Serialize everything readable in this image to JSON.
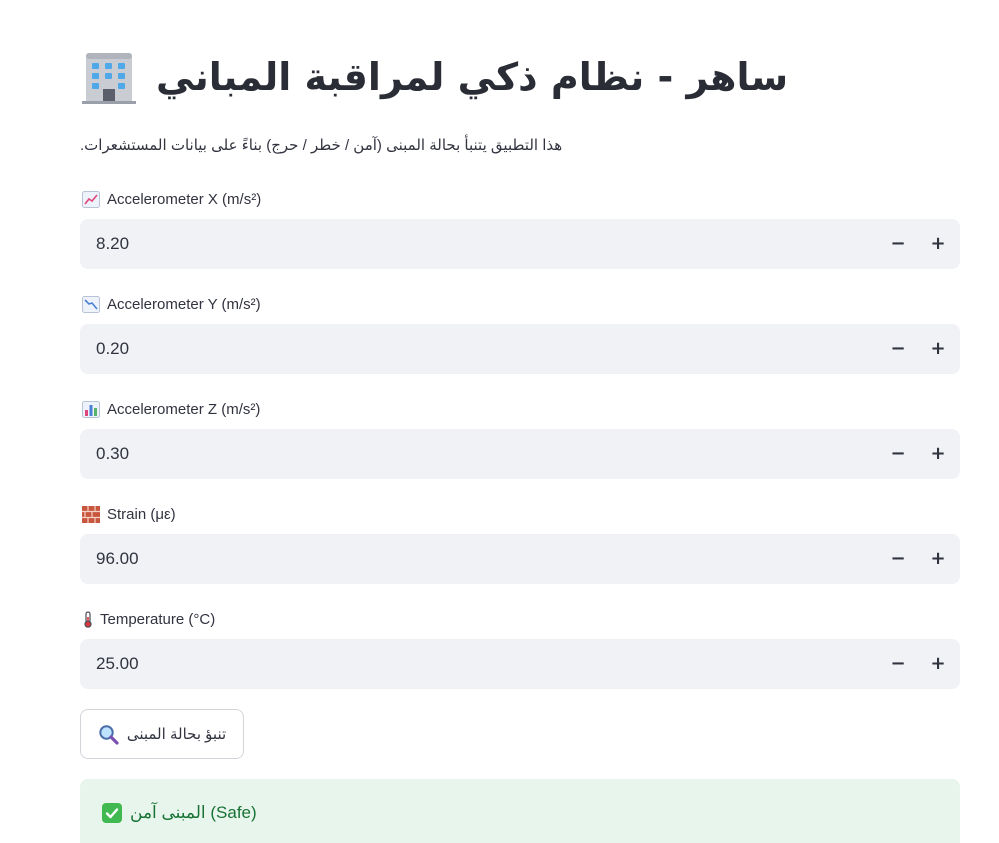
{
  "header": {
    "title": "ساهر - نظام ذكي لمراقبة المباني",
    "title_icon": "office-building-icon"
  },
  "description": ".هذا التطبيق يتنبأ بحالة المبنى (آمن / خطر / حرج) بناءً على بيانات المستشعرات",
  "fields": [
    {
      "label": "Accelerometer X (m/s²)",
      "icon": "chart-increasing-icon",
      "value": "8.20",
      "minus": "−",
      "plus": "+"
    },
    {
      "label": "Accelerometer Y (m/s²)",
      "icon": "chart-decreasing-icon",
      "value": "0.20",
      "minus": "−",
      "plus": "+"
    },
    {
      "label": "Accelerometer Z (m/s²)",
      "icon": "bar-chart-icon",
      "value": "0.30",
      "minus": "−",
      "plus": "+"
    },
    {
      "label": "Strain (με)",
      "icon": "brick-icon",
      "value": "96.00",
      "minus": "−",
      "plus": "+"
    },
    {
      "label": "Temperature (°C)",
      "icon": "thermometer-icon",
      "value": "25.00",
      "minus": "−",
      "plus": "+"
    }
  ],
  "predict_button": {
    "label": "تنبؤ بحالة المبنى",
    "icon": "magnifier-icon"
  },
  "result": {
    "text": "المبنى آمن (Safe)",
    "icon": "check-mark-icon",
    "status_color": "#177233",
    "background_color": "#e8f5ec"
  }
}
